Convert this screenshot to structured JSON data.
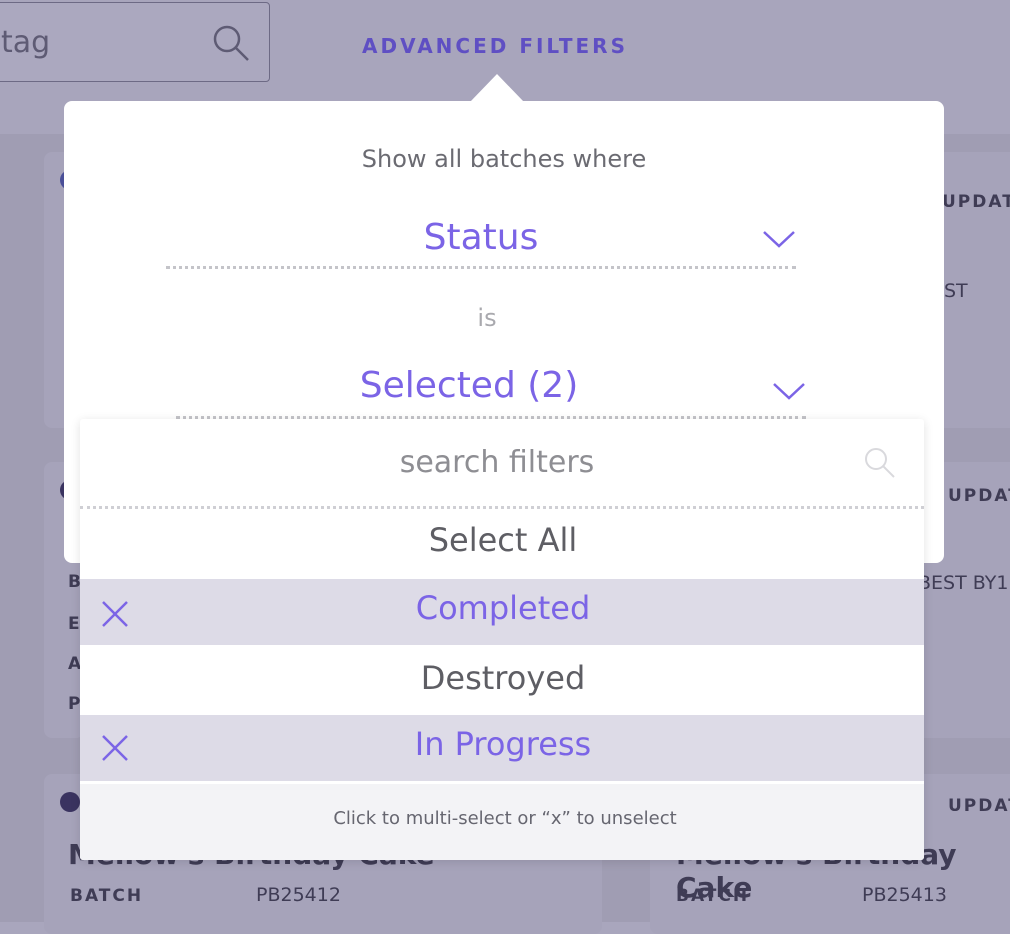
{
  "header": {
    "search_value": "tag",
    "advanced_filters_label": "ADVANCED FILTERS"
  },
  "background_cards": {
    "right_top_label": "UPDATE",
    "right_top_value": "ST",
    "right_mid_label": "UPDAT",
    "right_mid_value": "BEST BY1",
    "left_mid_letters": [
      "B",
      "E",
      "A",
      "P"
    ],
    "bottom_left": {
      "title": "Mellow's Birthday Cake",
      "batch_label": "BATCH",
      "batch_value": "PB25412"
    },
    "bottom_right": {
      "updated_label": "UPDAT",
      "title": "Mellow's Birthday Cake",
      "batch_label": "BATCH",
      "batch_value": "PB25413"
    }
  },
  "filter_popover": {
    "heading": "Show all batches where",
    "field_value": "Status",
    "operator_text": "is",
    "value_selection": "Selected (2)"
  },
  "dropdown": {
    "search_placeholder": "search filters",
    "select_all_label": "Select All",
    "options": [
      {
        "label": "Completed",
        "selected": true
      },
      {
        "label": "Destroyed",
        "selected": false
      },
      {
        "label": "In Progress",
        "selected": true
      }
    ],
    "hint": "Click to multi-select or “x” to unselect"
  },
  "colors": {
    "accent": "#7b64e6",
    "header_accent": "#5f4fc3",
    "overlay_bg": "#a9a6bd",
    "selected_row_bg": "#dddbe7"
  },
  "icons": [
    "search-icon",
    "chevron-down-icon",
    "close-icon"
  ]
}
